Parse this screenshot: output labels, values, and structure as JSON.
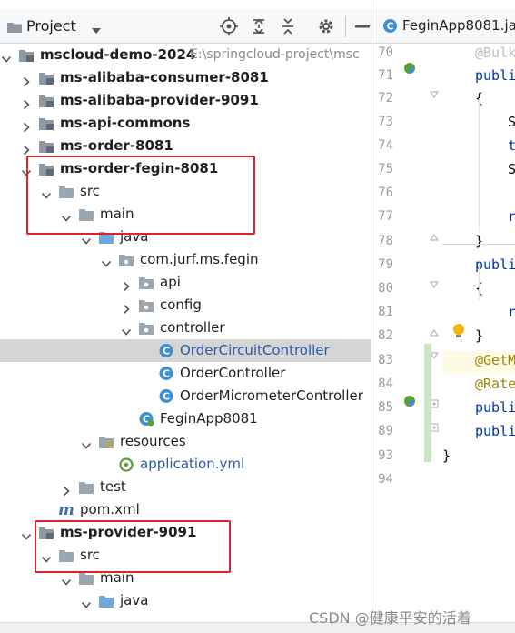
{
  "panel": {
    "title": "Project",
    "tree": [
      {
        "label": "mscloud-demo-2024",
        "path": "E:\\springcloud-project\\msc",
        "bold": true,
        "expanded": true
      },
      {
        "label": "ms-alibaba-consumer-8081",
        "bold": true,
        "expanded": false
      },
      {
        "label": "ms-alibaba-provider-9091",
        "bold": true,
        "expanded": false
      },
      {
        "label": "ms-api-commons",
        "bold": true,
        "expanded": false
      },
      {
        "label": "ms-order-8081",
        "bold": true,
        "expanded": false
      },
      {
        "label": "ms-order-fegin-8081",
        "bold": true,
        "expanded": true
      },
      {
        "label": "src",
        "expanded": true
      },
      {
        "label": "main",
        "expanded": true
      },
      {
        "label": "java",
        "expanded": true
      },
      {
        "label": "com.jurf.ms.fegin",
        "expanded": true
      },
      {
        "label": "api",
        "expanded": false
      },
      {
        "label": "config",
        "expanded": false
      },
      {
        "label": "controller",
        "expanded": true
      },
      {
        "label": "OrderCircuitController",
        "selected": true
      },
      {
        "label": "OrderController"
      },
      {
        "label": "OrderMicrometerController"
      },
      {
        "label": "FeginApp8081"
      },
      {
        "label": "resources",
        "expanded": true
      },
      {
        "label": "application.yml"
      },
      {
        "label": "test",
        "expanded": false
      },
      {
        "label": "pom.xml"
      },
      {
        "label": "ms-provider-9091",
        "bold": true,
        "expanded": true
      },
      {
        "label": "src",
        "expanded": true
      },
      {
        "label": "main",
        "expanded": true
      },
      {
        "label": "java",
        "expanded": true
      }
    ]
  },
  "editor": {
    "tab_label": "FeginApp8081.ja",
    "line_numbers": [
      "70",
      "71",
      "72",
      "73",
      "74",
      "75",
      "76",
      "77",
      "78",
      "79",
      "80",
      "81",
      "82",
      "83",
      "84",
      "85",
      "89",
      "93",
      "94"
    ],
    "code": {
      "l70": "@Bulk",
      "l71": "publi",
      "l72": "{",
      "l73": "S",
      "l74": "t",
      "l75": "S",
      "l77": "r",
      "l78": "}",
      "l79": "publi",
      "l80": "{",
      "l81": "r",
      "l82": "}",
      "l83": "@GetM",
      "l84": "@Rate",
      "l85": "publi",
      "l89": "publi",
      "l93": "}"
    }
  },
  "watermark": "CSDN @健康平安的活着",
  "colors": {
    "highlight_box": "#e0222a",
    "selection": "#d5d5d5",
    "class_blue": "#2b5aa8"
  }
}
